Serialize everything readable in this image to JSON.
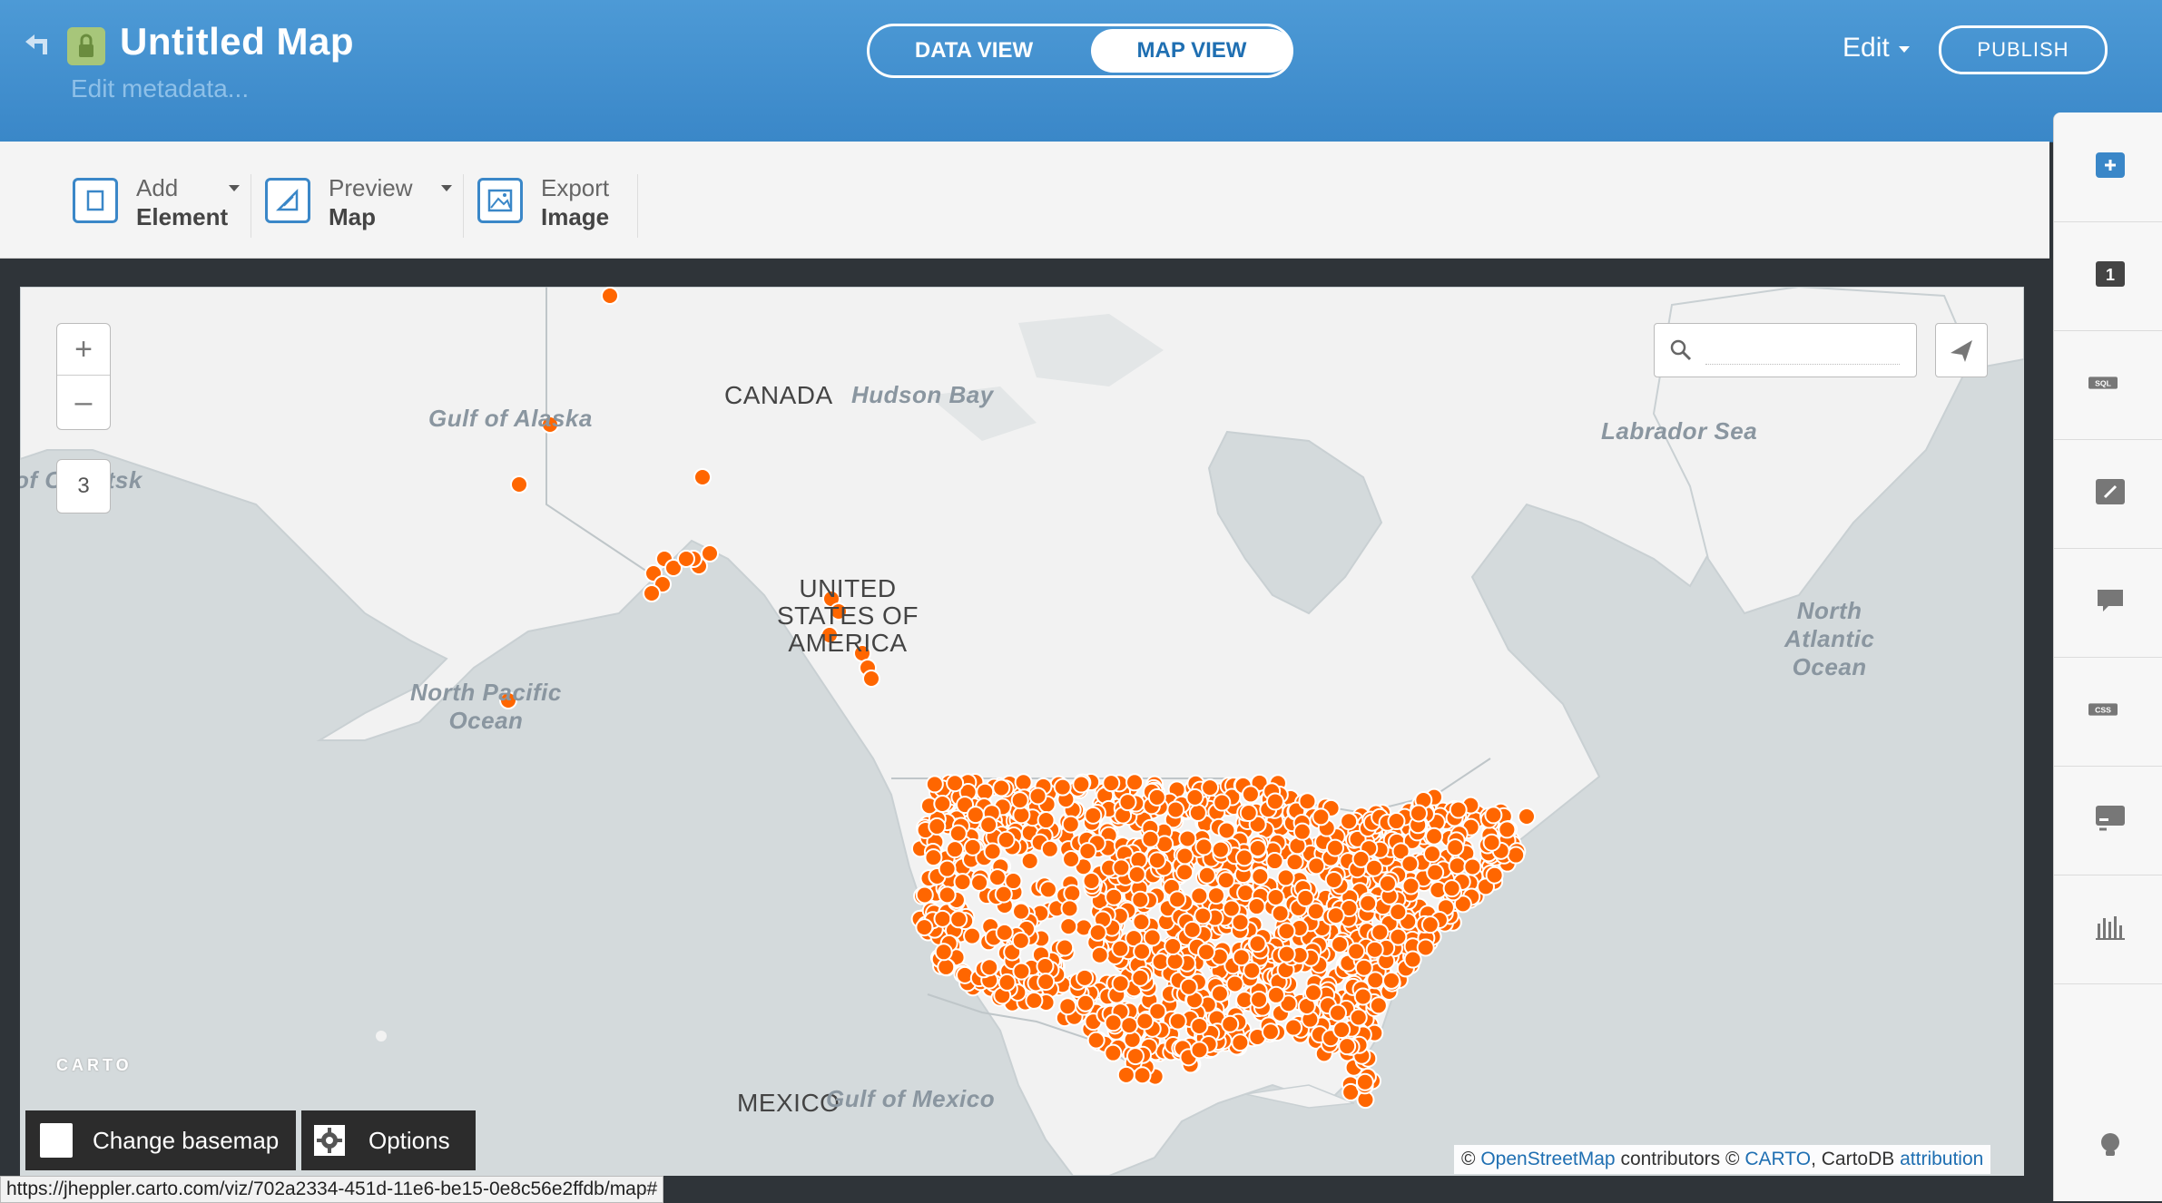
{
  "header": {
    "title": "Untitled Map",
    "edit_metadata": "Edit metadata...",
    "view_toggle": {
      "data_view": "DATA VIEW",
      "map_view": "MAP VIEW",
      "active": "MAP VIEW"
    },
    "edit_menu": "Edit",
    "publish": "PUBLISH"
  },
  "toolbar": {
    "add_element": {
      "line1": "Add",
      "line2": "Element"
    },
    "preview_map": {
      "line1": "Preview",
      "line2": "Map"
    },
    "export_image": {
      "line1": "Export",
      "line2": "Image"
    }
  },
  "map": {
    "zoom_in": "+",
    "zoom_out": "–",
    "zoom_level": "3",
    "search_placeholder": "",
    "labels": {
      "canada": "CANADA",
      "usa": "UNITED\nSTATES OF\nAMERICA",
      "mexico": "MEXICO",
      "hudson_bay": "Hudson Bay",
      "labrador_sea": "Labrador Sea",
      "gulf_of_alaska": "Gulf of Alaska",
      "okhotsk": "of Okhotsk",
      "north_pacific": "North Pacific\nOcean",
      "north_atlantic": "North\nAtlantic\nOcean",
      "gulf_of_mexico": "Gulf of Mexico"
    },
    "logo": "CARTO",
    "change_basemap": "Change basemap",
    "options": "Options",
    "attribution": {
      "prefix": "©",
      "osm": "OpenStreetMap",
      "contributors": "contributors ©",
      "carto": "CARTO",
      "cartodb": ", CartoDB",
      "attribution_link": "attribution"
    },
    "marker_color": "#ff6600"
  },
  "status_url": "https://jheppler.carto.com/viz/702a2334-451d-11e6-be15-0e8c56e2ffdb/map#",
  "rail": {
    "icons": [
      "add-layer-icon",
      "layer-1-icon",
      "sql-icon",
      "wizard-icon",
      "infowindow-icon",
      "css-icon",
      "legend-icon",
      "widgets-icon",
      "help-icon"
    ],
    "layer_number": "1",
    "sql_text": "SQL",
    "css_text": "CSS"
  }
}
